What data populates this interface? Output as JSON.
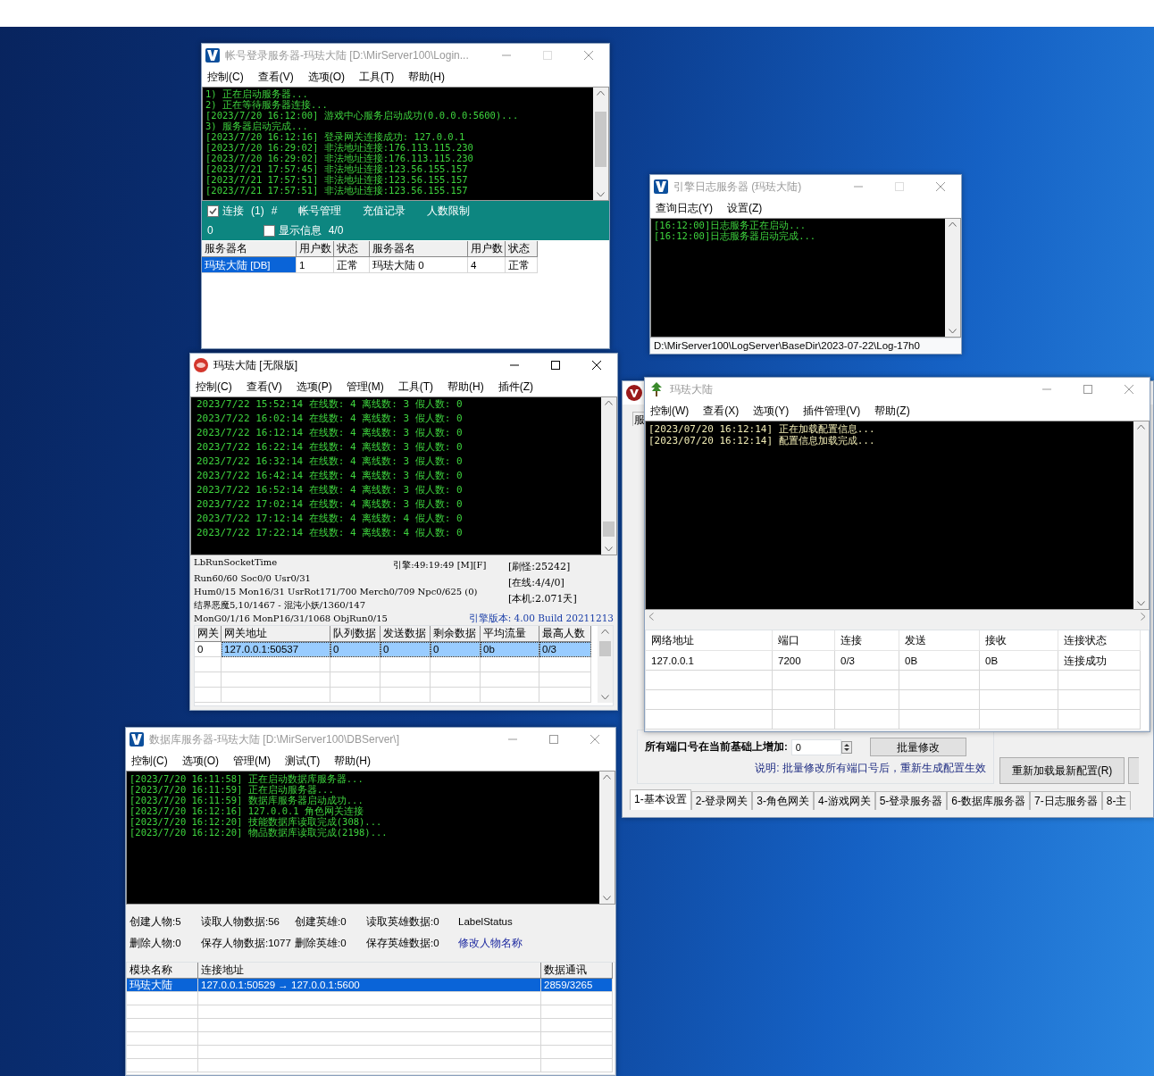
{
  "login_window": {
    "title": "帐号登录服务器-玛珐大陆  [D:\\MirServer100\\Login...",
    "active": false,
    "can_maximize": false,
    "menu": [
      "控制(C)",
      "查看(V)",
      "选项(O)",
      "工具(T)",
      "帮助(H)"
    ],
    "console": [
      "1) 正在启动服务器...",
      "2) 正在等待服务器连接...",
      "[2023/7/20 16:12:00] 游戏中心服务启动成功(0.0.0.0:5600)...",
      "3) 服务器启动完成...",
      "[2023/7/20 16:12:16] 登录网关连接成功: 127.0.0.1",
      "[2023/7/20 16:29:02] 非法地址连接:176.113.115.230",
      "[2023/7/20 16:29:02] 非法地址连接:176.113.115.230",
      "[2023/7/21 17:57:45] 非法地址连接:123.56.155.157",
      "[2023/7/21 17:57:51] 非法地址连接:123.56.155.157",
      "[2023/7/21 17:57:51] 非法地址连接:123.56.155.157"
    ],
    "panel": {
      "connect": {
        "label": "连接",
        "checked": true
      },
      "count": "(1)",
      "hash": "#",
      "links": [
        "帐号管理",
        "充值记录",
        "人数限制"
      ],
      "value": "0",
      "show_info": {
        "label": "显示信息",
        "checked": false
      },
      "ratio": "4/0"
    },
    "table": {
      "columns": [
        "服务器名",
        "用户数",
        "状态",
        "服务器名",
        "用户数",
        "状态"
      ],
      "rows": [
        {
          "cells": [
            "玛珐大陆 [DB]",
            "1",
            "正常",
            "玛珐大陆 0",
            "4",
            "正常"
          ],
          "selected": true
        }
      ]
    }
  },
  "log_window": {
    "title": "引擎日志服务器 (玛珐大陆)",
    "active": false,
    "can_maximize": false,
    "menu": [
      "查询日志(Y)",
      "设置(Z)"
    ],
    "console": [
      "[16:12:00]日志服务正在启动...",
      "[16:12:00]日志服务器启动完成..."
    ],
    "status_bar": "D:\\MirServer100\\LogServer\\BaseDir\\2023-07-22\\Log-17h0"
  },
  "main_window": {
    "title": "玛珐大陆 [无限版]",
    "active": true,
    "can_maximize": true,
    "menu": [
      "控制(C)",
      "查看(V)",
      "选项(P)",
      "管理(M)",
      "工具(T)",
      "帮助(H)",
      "插件(Z)"
    ],
    "console": [
      "2023/7/22 15:52:14 在线数: 4 离线数: 3 假人数: 0",
      "2023/7/22 16:02:14 在线数: 4 离线数: 3 假人数: 0",
      "2023/7/22 16:12:14 在线数: 4 离线数: 3 假人数: 0",
      "2023/7/22 16:22:14 在线数: 4 离线数: 3 假人数: 0",
      "2023/7/22 16:32:14 在线数: 4 离线数: 3 假人数: 0",
      "2023/7/22 16:42:14 在线数: 4 离线数: 3 假人数: 0",
      "2023/7/22 16:52:14 在线数: 4 离线数: 3 假人数: 0",
      "2023/7/22 17:02:14 在线数: 4 离线数: 3 假人数: 0",
      "2023/7/22 17:12:14 在线数: 4 离线数: 4 假人数: 0",
      "2023/7/22 17:22:14 在线数: 4 离线数: 4 假人数: 0"
    ],
    "info": {
      "socket_time": "LbRunSocketTime",
      "engine_time": "引擎:49:19:49 [M][F]",
      "lines": [
        "Run60/60 Soc0/0 Usr0/31",
        "Hum0/15 Mon16/31 UsrRot171/700 Merch0/709 Npc0/625 (0)",
        "结界恶魔5,10/1467 - 混沌小妖/1360/147"
      ],
      "last_line": "MonG0/1/16 MonP16/31/1068 ObjRun0/15",
      "stats": [
        "[刷怪:25242]",
        "[在线:4/4/0]",
        "[本机:2.071天]"
      ],
      "version": "引擎版本: 4.00 Build 20211213"
    },
    "table": {
      "columns": [
        "网关",
        "网关地址",
        "队列数据",
        "发送数据",
        "剩余数据",
        "平均流量",
        "最高人数"
      ],
      "rows": [
        {
          "cells": [
            "0",
            "127.0.0.1:50537",
            "0",
            "0",
            "0",
            "0b",
            "0/3"
          ],
          "selected": true
        }
      ]
    }
  },
  "gate_window": {
    "tab_fragment": "服",
    "port_label": "所有端口号在当前基础上增加:",
    "port_value": "0",
    "batch_button": "批量修改",
    "note": "说明: 批量修改所有端口号后，重新生成配置生效",
    "reload_button": "重新加载最新配置(R)",
    "tabs": [
      {
        "label": "1-基本设置",
        "selected": true
      },
      {
        "label": "2-登录网关",
        "selected": false
      },
      {
        "label": "3-角色网关",
        "selected": false
      },
      {
        "label": "4-游戏网关",
        "selected": false
      },
      {
        "label": "5-登录服务器",
        "selected": false
      },
      {
        "label": "6-数据库服务器",
        "selected": false
      },
      {
        "label": "7-日志服务器",
        "selected": false
      },
      {
        "label": "8-主",
        "selected": false
      }
    ]
  },
  "gate_log_window": {
    "title": "玛珐大陆",
    "active": false,
    "can_maximize": true,
    "menu": [
      "控制(W)",
      "查看(X)",
      "选项(Y)",
      "插件管理(V)",
      "帮助(Z)"
    ],
    "console": [
      "[2023/07/20 16:12:14] 正在加载配置信息...",
      "[2023/07/20 16:12:14] 配置信息加载完成..."
    ],
    "table": {
      "columns": [
        "网络地址",
        "端口",
        "连接",
        "发送",
        "接收",
        "连接状态"
      ],
      "rows": [
        {
          "cells": [
            "127.0.0.1",
            "7200",
            "0/3",
            "0B",
            "0B",
            "连接成功"
          ],
          "selected": false
        }
      ]
    }
  },
  "db_window": {
    "title": "数据库服务器-玛珐大陆  [D:\\MirServer100\\DBServer\\]",
    "active": false,
    "can_maximize": true,
    "menu": [
      "控制(C)",
      "选项(O)",
      "管理(M)",
      "测试(T)",
      "帮助(H)"
    ],
    "console": [
      "[2023/7/20 16:11:58] 正在启动数据库服务器...",
      "[2023/7/20 16:11:59] 正在启动服务器...",
      "[2023/7/20 16:11:59] 数据库服务器启动成功...",
      "[2023/7/20 16:12:16] 127.0.0.1 角色网关连接",
      "[2023/7/20 16:12:20] 技能数据库读取完成(308)...",
      "[2023/7/20 16:12:20] 物品数据库读取完成(2198)..."
    ],
    "stats": [
      {
        "kind": "label",
        "text": "创建人物:5"
      },
      {
        "kind": "label",
        "text": "读取人物数据:56"
      },
      {
        "kind": "label",
        "text": "创建英雄:0"
      },
      {
        "kind": "label",
        "text": "读取英雄数据:0"
      },
      {
        "kind": "label",
        "text": "LabelStatus"
      },
      {
        "kind": "label",
        "text": "删除人物:0"
      },
      {
        "kind": "label",
        "text": "保存人物数据:1077"
      },
      {
        "kind": "label",
        "text": "删除英雄:0"
      },
      {
        "kind": "label",
        "text": "保存英雄数据:0"
      },
      {
        "kind": "link",
        "text": "修改人物名称"
      }
    ],
    "table": {
      "columns": [
        "模块名称",
        "连接地址",
        "数据通讯"
      ],
      "rows": [
        {
          "cells": [
            "玛珐大陆",
            "127.0.0.1:50529 → 127.0.0.1:5600",
            "2859/3265"
          ],
          "selected": true
        }
      ]
    }
  }
}
